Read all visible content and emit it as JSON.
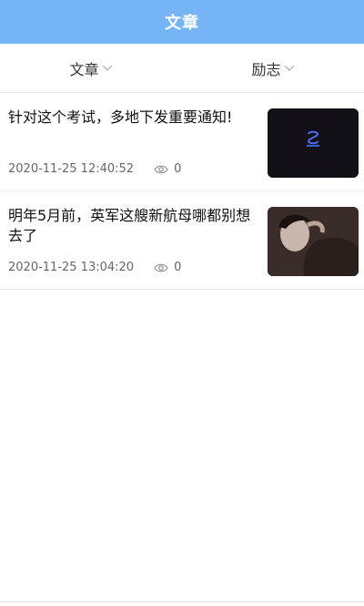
{
  "header": {
    "title": "文章"
  },
  "filters": [
    {
      "label": "文章",
      "icon": "chevron-down-icon"
    },
    {
      "label": "励志",
      "icon": "chevron-down-icon"
    }
  ],
  "articles": [
    {
      "title": "针对这个考试，多地下发重要通知!",
      "date": "2020-11-25 12:40:52",
      "views": "0",
      "thumbnail": "logo-on-dark-image"
    },
    {
      "title": "明年5月前，英军这艘新航母哪都别想去了",
      "date": "2020-11-25 13:04:20",
      "views": "0",
      "thumbnail": "portrait-photo"
    }
  ],
  "colors": {
    "header_bg": "#75b5f5",
    "header_text": "#ffffff"
  }
}
